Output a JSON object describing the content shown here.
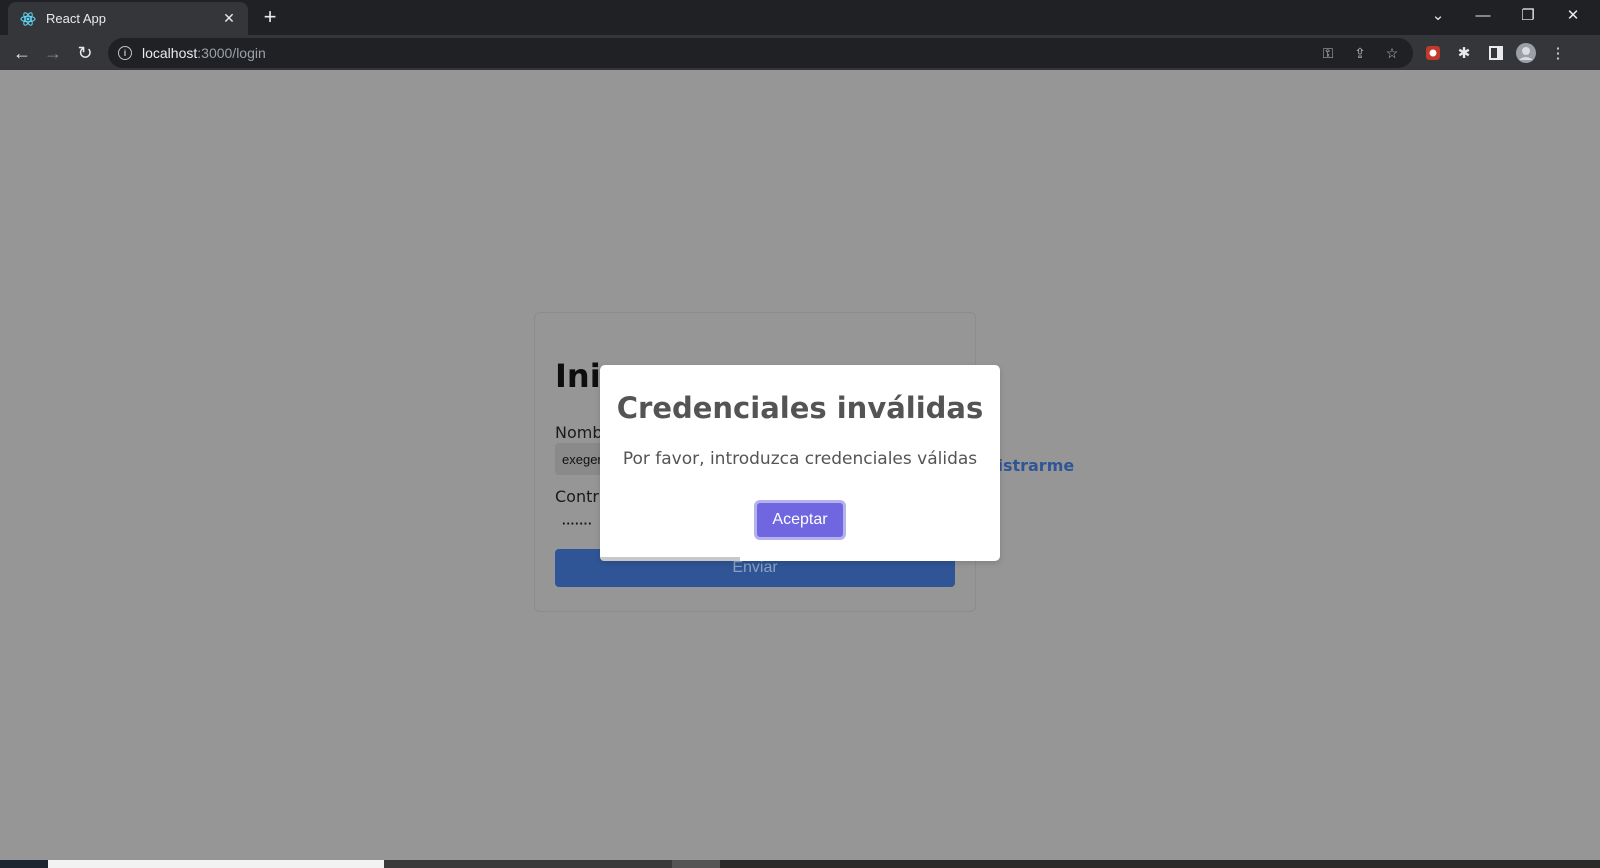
{
  "browser": {
    "tab_title": "React App",
    "url_host": "localhost",
    "url_path": ":3000/login"
  },
  "login": {
    "title": "Inic",
    "username_label": "Nombr",
    "username_value": "exeger",
    "password_label": "Contra",
    "password_value": "·······",
    "submit_label": "Enviar",
    "register_link": "gistrarme"
  },
  "modal": {
    "title": "Credenciales inválidas",
    "message": "Por favor, introduzca credenciales válidas",
    "confirm_label": "Aceptar"
  },
  "colors": {
    "overlay": "#969696",
    "confirm_button": "#7066e0",
    "submit_button": "#2f5597"
  }
}
